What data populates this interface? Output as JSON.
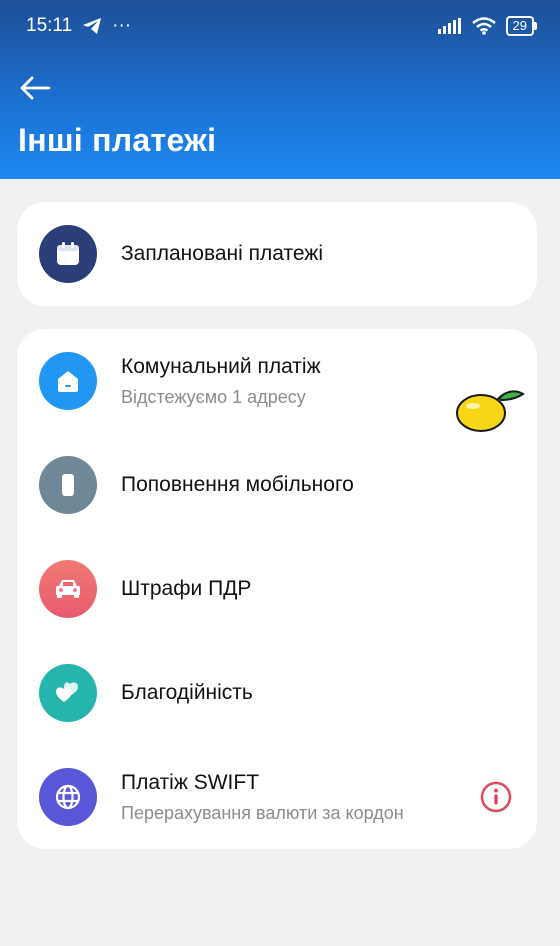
{
  "status_bar": {
    "time": "15:11",
    "battery": "29",
    "more": "···"
  },
  "header": {
    "title": "Інші платежі"
  },
  "scheduled": {
    "label": "Заплановані платежі"
  },
  "items": [
    {
      "id": "utility",
      "title": "Комунальний платіж",
      "subtitle": "Відстежуємо 1 адресу"
    },
    {
      "id": "mobile",
      "title": "Поповнення мобільного"
    },
    {
      "id": "fines",
      "title": "Штрафи ПДР"
    },
    {
      "id": "charity",
      "title": "Благодійність"
    },
    {
      "id": "swift",
      "title": "Платіж SWIFT",
      "subtitle": "Перерахування валюти за кордон"
    }
  ],
  "colors": {
    "header_top": "#1f4f96",
    "header_bottom": "#1d8af2",
    "calendar": "#2c3e78",
    "utility": "#2196f3",
    "mobile": "#6f8796",
    "fines": "#ee6570",
    "charity": "#25b5ad",
    "swift": "#5a56d8",
    "info": "#e0475a"
  },
  "icons": [
    "back-arrow-icon",
    "calendar-icon",
    "house-icon",
    "phone-icon",
    "car-icon",
    "hearts-icon",
    "globe-icon",
    "info-icon",
    "lemon-icon"
  ]
}
